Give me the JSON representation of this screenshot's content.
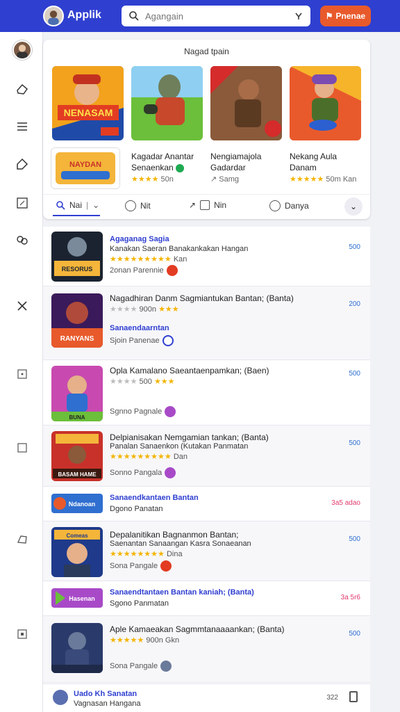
{
  "header": {
    "title": "Applik",
    "search_placeholder": "Agangain",
    "promo_label": "Pnenae"
  },
  "featured": {
    "title": "Nagad tpain",
    "apps": [
      {
        "name": "Kagadar Anantar",
        "sub": "Senaenkan",
        "meta": "50n"
      },
      {
        "name": "Nengiamajola",
        "sub": "Gadardar",
        "meta": "Samg"
      },
      {
        "name": "Nekang Aula",
        "sub": "Danam",
        "meta": "50m Kan"
      }
    ],
    "card_labels": [
      "NENASAM",
      "NAYDAN"
    ],
    "tabs": [
      {
        "label": "Nai"
      },
      {
        "label": "Nit"
      },
      {
        "label": "Nin"
      },
      {
        "label": "Danya"
      }
    ]
  },
  "list": [
    {
      "title": "Agaganag Sagia",
      "sub": "Kanakan Saeran Banakankakan Hangan",
      "stars": "Kan",
      "meta": "2onan Parennie",
      "price": "500",
      "thumb_text": "RESORUS"
    },
    {
      "title": "Nagadhiran Danm Sagmiantukan Bantan; (Banta)",
      "sub": "Sanaendaarntan",
      "stars": "900n",
      "meta": "Sjoin Panenae",
      "price": "200",
      "thumb_text": "RANYANS"
    },
    {
      "title": "Opla Kamalano Saeantaenpamkan; (Baen)",
      "sub": "",
      "stars": "500",
      "meta": "Sgnno Pagnale",
      "price": "500",
      "thumb_text": "BUNA"
    },
    {
      "title": "Delpianisakan Nemgamian tankan; (Banta)",
      "sub": "Panalan Sanaenkon (Kutakan Panmatan",
      "stars": "Dan",
      "meta": "Sonno Pangala",
      "price": "500",
      "thumb_text": "BASAM HAME"
    },
    {
      "title": "Sanaendkantaen Bantan",
      "sub": "Dgono Panatan",
      "price": "3a5 adao",
      "thumb_text": "Ndanoan"
    },
    {
      "title": "Depalanitikan Bagnanmon Bantan;",
      "sub": "Saenantan Sanaangan Kasra Sonaeanan",
      "stars": "Dina",
      "meta": "Sona Pangale",
      "price": "500",
      "thumb_text": "Comeas"
    },
    {
      "title": "Sanaendtantaen Bantan kaniah; (Banta)",
      "sub": "Sgono Panmatan",
      "price": "3a 5r6",
      "thumb_text": "Hasenan"
    },
    {
      "title": "Aple Kamaeakan Sagmmtanaaaankan; (Banta)",
      "sub": "",
      "stars": "900n Gkn",
      "meta": "Sona Pangale",
      "price": "500",
      "thumb_text": ""
    }
  ],
  "footer": {
    "title": "Uado Kh Sanatan",
    "sub": "Vagnasan Hangana",
    "count": "322"
  },
  "colors": {
    "brand": "#2f3fd0",
    "accent": "#e85a2c",
    "link": "#2f6fd0"
  }
}
